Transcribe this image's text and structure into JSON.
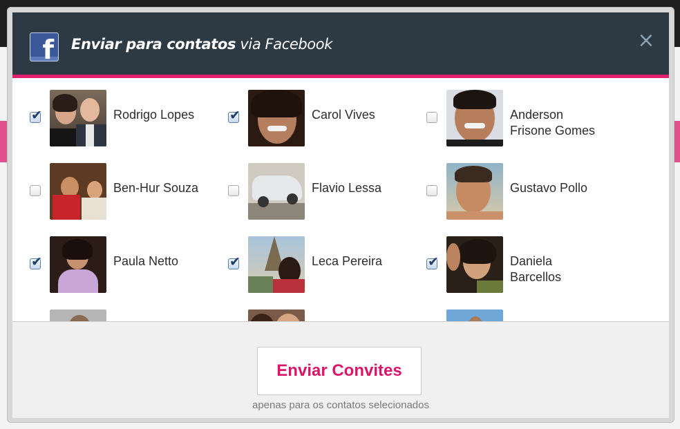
{
  "dialog": {
    "title_bold": "Enviar para contatos",
    "title_rest": " via Facebook",
    "logo_glyph": "f",
    "close_glyph": "×"
  },
  "contacts": [
    {
      "name": "Rodrigo Lopes",
      "checked": true
    },
    {
      "name": "Carol Vives",
      "checked": true
    },
    {
      "name": "Anderson Frisone Gomes",
      "checked": false
    },
    {
      "name": "Ben-Hur Souza",
      "checked": false
    },
    {
      "name": "Flavio Lessa",
      "checked": false
    },
    {
      "name": "Gustavo Pollo",
      "checked": false
    },
    {
      "name": "Paula Netto",
      "checked": true
    },
    {
      "name": "Leca Pereira",
      "checked": true
    },
    {
      "name": "Daniela Barcellos",
      "checked": true
    }
  ],
  "footer": {
    "send_label": "Enviar Convites",
    "hint": "apenas para os contatos selecionados"
  },
  "colors": {
    "header_bg": "#2d3a44",
    "accent": "#e0206e",
    "send_text": "#d8176b"
  },
  "check_glyph": "✔"
}
